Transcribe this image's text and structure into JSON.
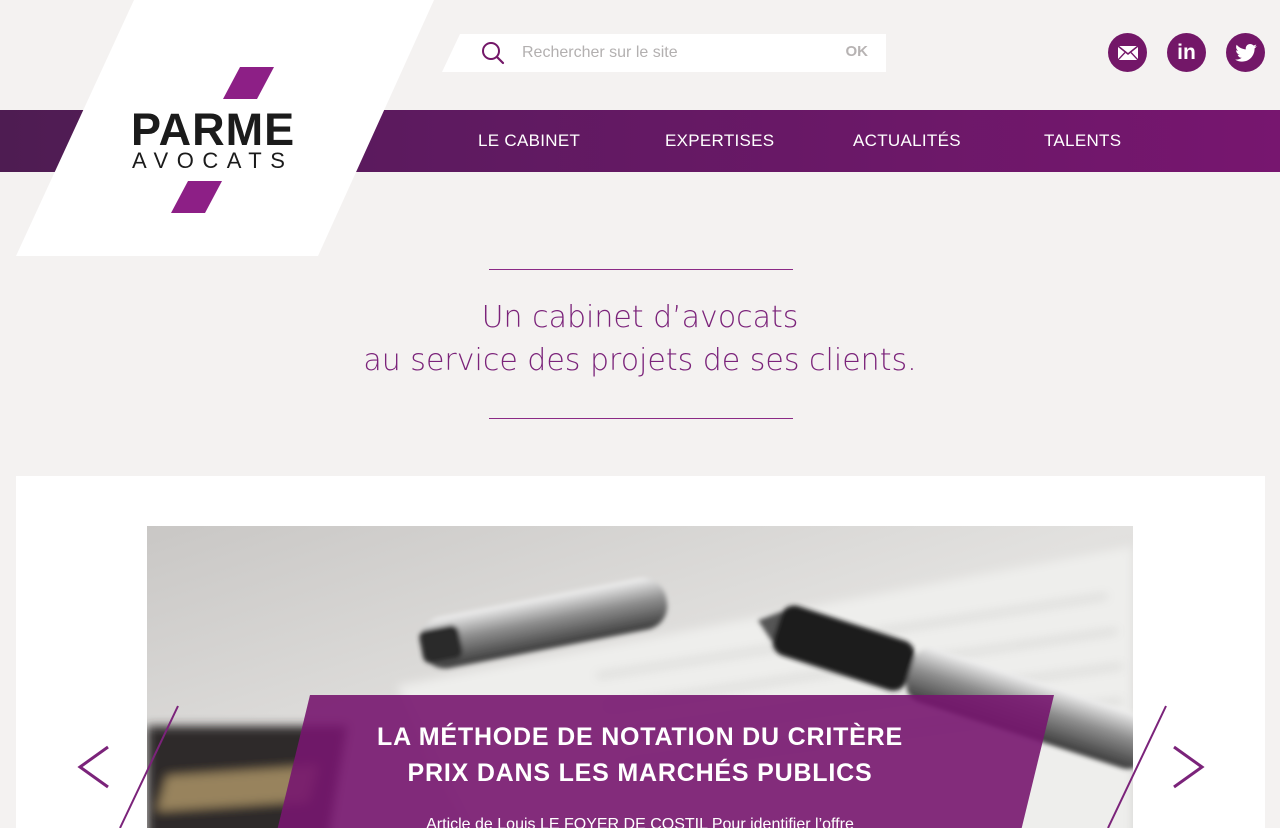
{
  "brand": {
    "name_top": "PARME",
    "name_bottom": "AVOCATS",
    "accent_color": "#731768"
  },
  "search": {
    "placeholder": "Rechercher sur le site",
    "value": "",
    "submit_label": "OK",
    "icon": "search-icon"
  },
  "social": [
    {
      "name": "mail",
      "icon": "envelope-icon"
    },
    {
      "name": "linkedin",
      "label": "in",
      "icon": "linkedin-icon"
    },
    {
      "name": "twitter",
      "icon": "twitter-bird-icon"
    }
  ],
  "nav": {
    "items": [
      {
        "label": "LE CABINET"
      },
      {
        "label": "EXPERTISES"
      },
      {
        "label": "ACTUALITÉS"
      },
      {
        "label": "TALENTS"
      }
    ]
  },
  "tagline": {
    "line1": "Un cabinet d’avocats",
    "line2": "au service des projets de ses clients."
  },
  "slider": {
    "title_line1": "LA MÉTHODE DE NOTATION DU CRITÈRE",
    "title_line2": "PRIX DANS LES MARCHÉS PUBLICS",
    "excerpt": "Article de Louis LE FOYER DE COSTIL Pour identifier l’offre",
    "prev_icon": "chevron-left-icon",
    "next_icon": "chevron-right-icon"
  }
}
